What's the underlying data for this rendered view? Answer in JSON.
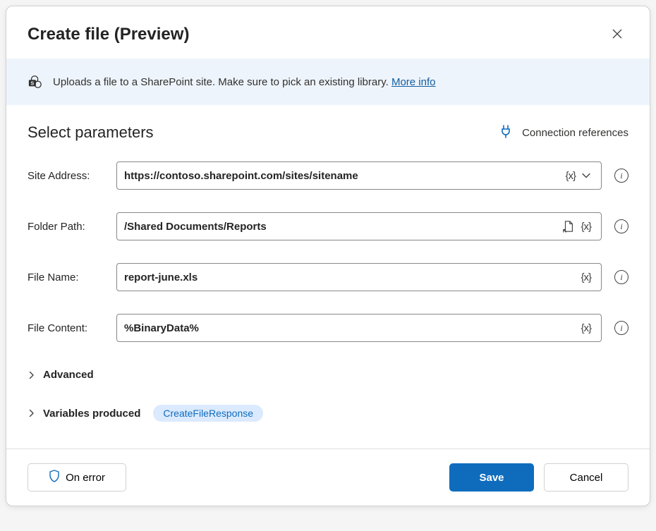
{
  "header": {
    "title": "Create file (Preview)"
  },
  "infoBar": {
    "text": "Uploads a file to a SharePoint site. Make sure to pick an existing library. ",
    "linkText": "More info"
  },
  "params": {
    "title": "Select parameters",
    "connRefs": "Connection references",
    "varBrace": "{x}",
    "fields": {
      "siteAddress": {
        "label": "Site Address:",
        "value": "https://contoso.sharepoint.com/sites/sitename"
      },
      "folderPath": {
        "label": "Folder Path:",
        "value": "/Shared Documents/Reports"
      },
      "fileName": {
        "label": "File Name:",
        "value": "report-june.xls"
      },
      "fileContent": {
        "label": "File Content:",
        "value": "%BinaryData%"
      }
    },
    "advanced": {
      "label": "Advanced"
    },
    "variablesProduced": {
      "label": "Variables produced",
      "badge": "CreateFileResponse"
    }
  },
  "footer": {
    "onError": "On error",
    "save": "Save",
    "cancel": "Cancel"
  }
}
